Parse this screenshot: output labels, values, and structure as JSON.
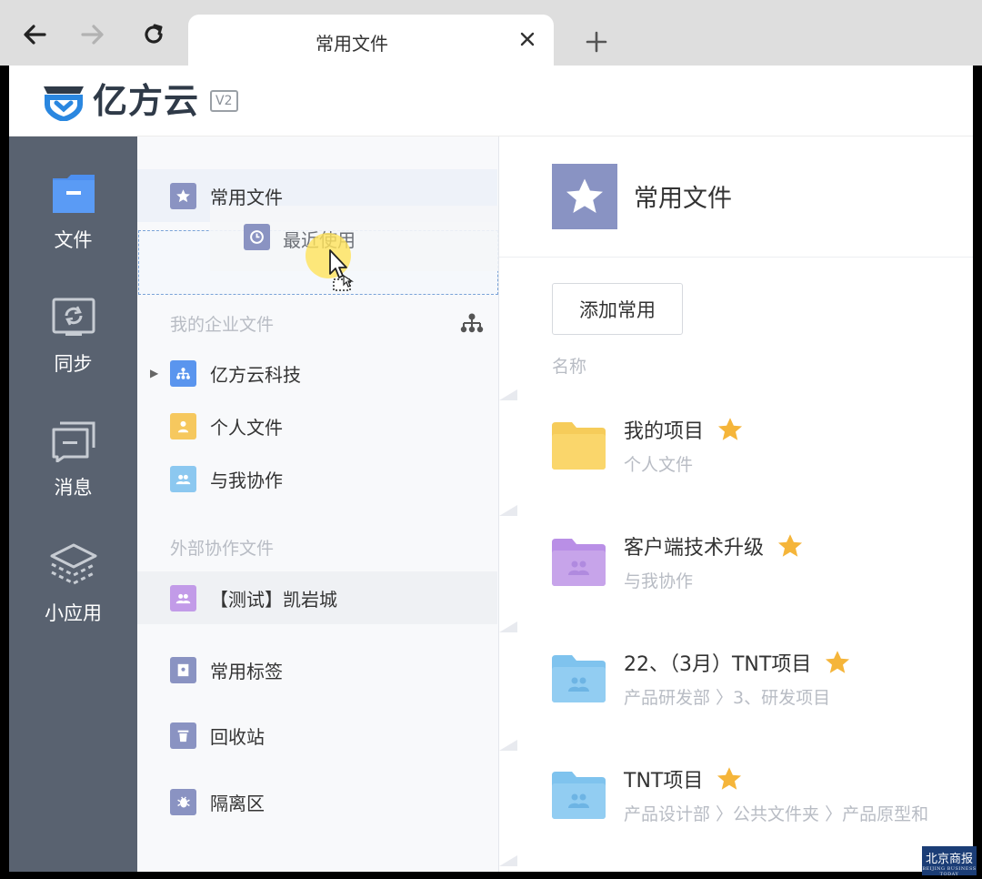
{
  "browser": {
    "tab_title": "常用文件"
  },
  "app": {
    "logo_text": "亿方云",
    "version": "V2"
  },
  "rail": {
    "items": [
      {
        "label": "文件",
        "icon": "folder-icon"
      },
      {
        "label": "同步",
        "icon": "sync-icon"
      },
      {
        "label": "消息",
        "icon": "message-icon"
      },
      {
        "label": "小应用",
        "icon": "apps-icon"
      }
    ]
  },
  "tree": {
    "favorites": "常用文件",
    "recent_dragging": "最近使用",
    "section_enterprise": "我的企业文件",
    "enterprise": "亿方云科技",
    "personal": "个人文件",
    "shared": "与我协作",
    "section_external": "外部协作文件",
    "external_item": "【测试】凯岩城",
    "tags": "常用标签",
    "trash": "回收站",
    "quarantine": "隔离区"
  },
  "main": {
    "title": "常用文件",
    "add_button": "添加常用",
    "column_name": "名称",
    "files": [
      {
        "name": "我的项目",
        "path": "个人文件",
        "folder_color": "#fad66b"
      },
      {
        "name": "客户端技术升级",
        "path": "与我协作",
        "folder_color": "#c7a4ea"
      },
      {
        "name": "22、（3月）TNT项目",
        "path": "产品研发部 〉3、研发项目",
        "folder_color": "#92cdf2"
      },
      {
        "name": "TNT项目",
        "path": "产品设计部 〉公共文件夹 〉产品原型和",
        "folder_color": "#92cdf2"
      }
    ]
  },
  "watermark": {
    "text": "北京商报",
    "sub": "BEIJING BUSINESS TODAY"
  },
  "colors": {
    "rail_bg": "#596270",
    "accent_blue": "#4d8ff0",
    "star": "#f5b53a"
  }
}
